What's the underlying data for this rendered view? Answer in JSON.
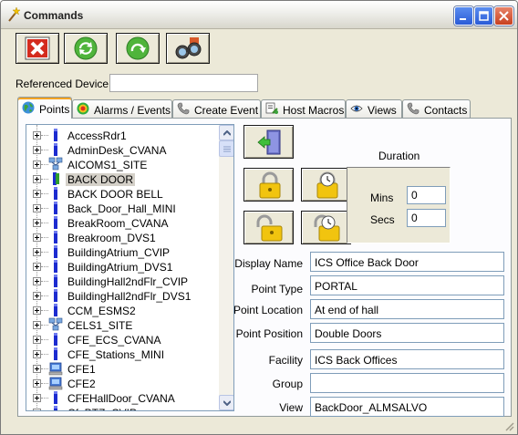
{
  "window": {
    "title": "Commands",
    "colors": {
      "face": "#ece9d8",
      "tab_accent": "#f4a424",
      "close_red": "#c7401f"
    }
  },
  "toolbar": {
    "buttons": [
      {
        "icon": "cancel-x-icon"
      },
      {
        "icon": "refresh-icon"
      },
      {
        "icon": "redo-icon"
      },
      {
        "icon": "binoculars-icon"
      }
    ]
  },
  "referenced_device": {
    "label": "Referenced Device",
    "value": ""
  },
  "tabs": [
    {
      "label": "Points",
      "icon": "globe-icon",
      "active": true
    },
    {
      "label": "Alarms / Events",
      "icon": "target-icon"
    },
    {
      "label": "Create Event",
      "icon": "phone-icon"
    },
    {
      "label": "Host Macros",
      "icon": "macro-icon"
    },
    {
      "label": "Views",
      "icon": "eye-icon"
    },
    {
      "label": "Contacts",
      "icon": "phone-icon"
    }
  ],
  "tree": {
    "items": [
      {
        "label": "AccessRdr1",
        "icon": "device-icon"
      },
      {
        "label": "AdminDesk_CVANA",
        "icon": "device-icon"
      },
      {
        "label": "AICOMS1_SITE",
        "icon": "network-icon"
      },
      {
        "label": "BACK DOOR",
        "icon": "door-icon",
        "selected": true
      },
      {
        "label": "BACK DOOR BELL",
        "icon": "device-icon"
      },
      {
        "label": "Back_Door_Hall_MINI",
        "icon": "device-icon"
      },
      {
        "label": "BreakRoom_CVANA",
        "icon": "device-icon"
      },
      {
        "label": "Breakroom_DVS1",
        "icon": "device-icon"
      },
      {
        "label": "BuildingAtrium_CVIP",
        "icon": "device-icon"
      },
      {
        "label": "BuildingAtrium_DVS1",
        "icon": "device-icon"
      },
      {
        "label": "BuildingHall2ndFlr_CVIP",
        "icon": "device-icon"
      },
      {
        "label": "BuildingHall2ndFlr_DVS1",
        "icon": "device-icon"
      },
      {
        "label": "CCM_ESMS2",
        "icon": "device-icon"
      },
      {
        "label": "CELS1_SITE",
        "icon": "network-icon"
      },
      {
        "label": "CFE_ECS_CVANA",
        "icon": "device-icon"
      },
      {
        "label": "CFE_Stations_MINI",
        "icon": "device-icon"
      },
      {
        "label": "CFE1",
        "icon": "computer-icon"
      },
      {
        "label": "CFE2",
        "icon": "computer-icon"
      },
      {
        "label": "CFEHallDoor_CVANA",
        "icon": "device-icon"
      },
      {
        "label": "CfePTZ_CVIP",
        "icon": "device-icon"
      }
    ]
  },
  "actions": [
    {
      "icon": "exit-door-icon"
    },
    {
      "icon": "lock-icon"
    },
    {
      "icon": "lock-timer-icon"
    },
    {
      "icon": "unlock-icon"
    },
    {
      "icon": "unlock-timer-icon"
    }
  ],
  "duration": {
    "title": "Duration",
    "mins_label": "Mins",
    "mins_value": "0",
    "secs_label": "Secs",
    "secs_value": "0"
  },
  "details": {
    "display_name": {
      "label": "Display Name",
      "value": "ICS Office Back Door"
    },
    "point_type": {
      "label": "Point Type",
      "value": "PORTAL"
    },
    "point_location": {
      "label": "Point Location",
      "value": "At end of hall"
    },
    "point_position": {
      "label": "Point Position",
      "value": "Double Doors"
    },
    "facility": {
      "label": "Facility",
      "value": "ICS Back Offices"
    },
    "group": {
      "label": "Group",
      "value": ""
    },
    "view": {
      "label": "View",
      "value": "BackDoor_ALMSALVO"
    }
  }
}
